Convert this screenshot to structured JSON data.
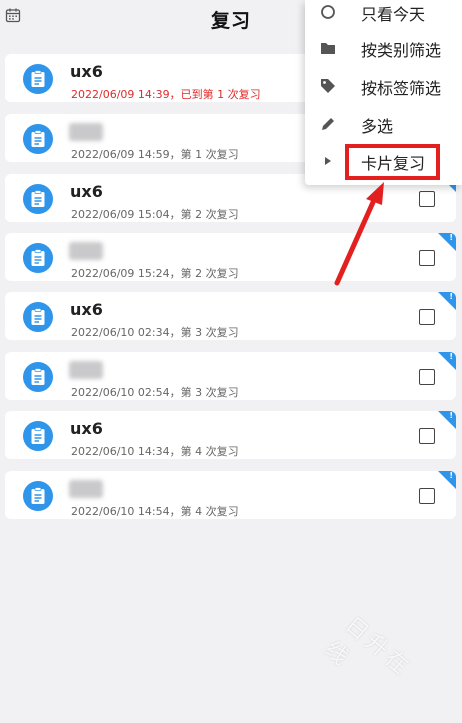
{
  "header": {
    "title": "复习",
    "calendar_icon": "calendar-icon"
  },
  "colors": {
    "accent": "#2e95ea",
    "due": "#e12a2a",
    "highlight": "#e22020",
    "background": "#f1f1f4"
  },
  "items": [
    {
      "name": "ux6",
      "blurred": false,
      "subtitle": "2022/06/09 14:39，已到第 1 次复习",
      "due": true,
      "checkbox": false,
      "flag": false
    },
    {
      "name": "",
      "blurred": true,
      "subtitle": "2022/06/09 14:59，第 1 次复习",
      "due": false,
      "checkbox": false,
      "flag": false
    },
    {
      "name": "ux6",
      "blurred": false,
      "subtitle": "2022/06/09 15:04，第 2 次复习",
      "due": false,
      "checkbox": true,
      "flag": true
    },
    {
      "name": "",
      "blurred": true,
      "subtitle": "2022/06/09 15:24，第 2 次复习",
      "due": false,
      "checkbox": true,
      "flag": true
    },
    {
      "name": "ux6",
      "blurred": false,
      "subtitle": "2022/06/10 02:34，第 3 次复习",
      "due": false,
      "checkbox": true,
      "flag": true
    },
    {
      "name": "",
      "blurred": true,
      "subtitle": "2022/06/10 02:54，第 3 次复习",
      "due": false,
      "checkbox": true,
      "flag": true
    },
    {
      "name": "ux6",
      "blurred": false,
      "subtitle": "2022/06/10 14:34，第 4 次复习",
      "due": false,
      "checkbox": true,
      "flag": true
    },
    {
      "name": "",
      "blurred": true,
      "subtitle": "2022/06/10 14:54，第 4 次复习",
      "due": false,
      "checkbox": true,
      "flag": true
    }
  ],
  "menu": {
    "items": [
      {
        "label": "只看今天",
        "icon": "circle-icon"
      },
      {
        "label": "按类别筛选",
        "icon": "folder-icon"
      },
      {
        "label": "按标签筛选",
        "icon": "tag-icon"
      },
      {
        "label": "多选",
        "icon": "pencil-icon"
      },
      {
        "label": "卡片复习",
        "icon": "play-triangle-icon"
      }
    ]
  },
  "watermark": "日升在线"
}
